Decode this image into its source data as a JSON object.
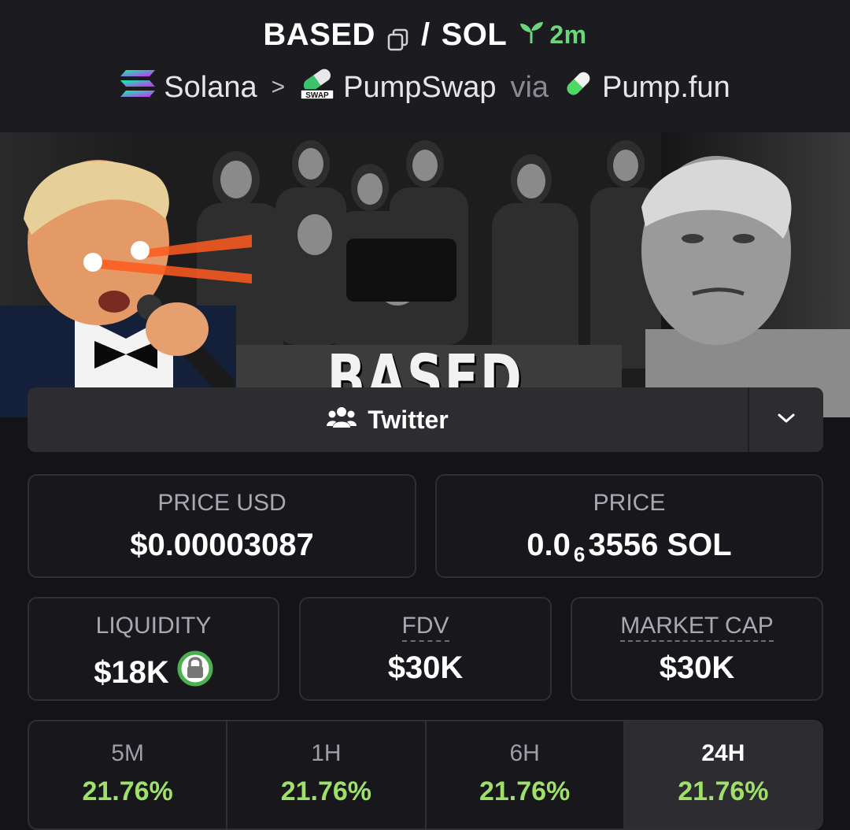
{
  "header": {
    "token_symbol": "BASED",
    "separator": "/",
    "quote_symbol": "SOL",
    "age": "2m",
    "chain": "Solana",
    "dex": "PumpSwap",
    "dex_badge": "SWAP",
    "via_label": "via",
    "launchpad": "Pump.fun"
  },
  "banner": {
    "text": "BASED"
  },
  "social": {
    "label": "Twitter"
  },
  "stats": {
    "price_usd": {
      "label": "PRICE USD",
      "value": "$0.00003087"
    },
    "price_native": {
      "label": "PRICE",
      "value_prefix": "0.0",
      "value_zeros": "6",
      "value_suffix": "3556 SOL"
    },
    "liquidity": {
      "label": "LIQUIDITY",
      "value": "$18K"
    },
    "fdv": {
      "label": "FDV",
      "value": "$30K"
    },
    "market_cap": {
      "label": "MARKET CAP",
      "value": "$30K"
    }
  },
  "changes": [
    {
      "period": "5M",
      "pct": "21.76%",
      "active": false
    },
    {
      "period": "1H",
      "pct": "21.76%",
      "active": false
    },
    {
      "period": "6H",
      "pct": "21.76%",
      "active": false
    },
    {
      "period": "24H",
      "pct": "21.76%",
      "active": true
    }
  ],
  "colors": {
    "positive": "#9fe06a",
    "age_green": "#6bd67b",
    "lock_green": "#4caf50"
  },
  "icons": [
    "copy-icon",
    "sprout-icon",
    "solana-logo-icon",
    "pumpswap-logo-icon",
    "pill-icon",
    "users-icon",
    "chevron-down-icon",
    "lock-icon"
  ]
}
